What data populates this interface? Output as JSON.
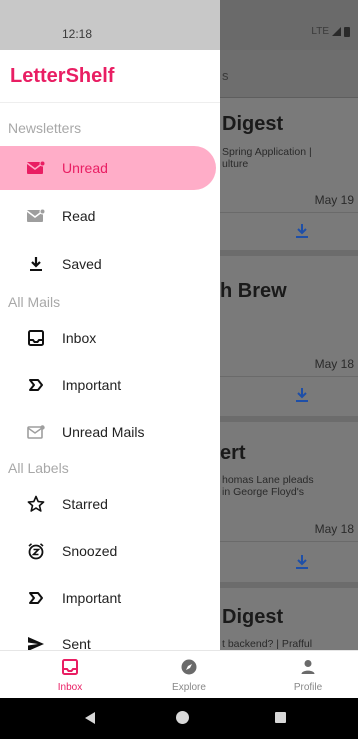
{
  "status_bar": {
    "time": "12:18",
    "network": "LTE"
  },
  "drawer": {
    "title": "LetterShelf",
    "sections": [
      {
        "header": "Newsletters",
        "items": [
          {
            "label": "Unread",
            "icon": "mail-unread-icon",
            "active": true
          },
          {
            "label": "Read",
            "icon": "mail-read-icon"
          },
          {
            "label": "Saved",
            "icon": "download-icon"
          }
        ]
      },
      {
        "header": "All Mails",
        "items": [
          {
            "label": "Inbox",
            "icon": "inbox-icon"
          },
          {
            "label": "Important",
            "icon": "important-icon"
          },
          {
            "label": "Unread Mails",
            "icon": "unread-mail-icon"
          }
        ]
      },
      {
        "header": "All Labels",
        "items": [
          {
            "label": "Starred",
            "icon": "star-icon"
          },
          {
            "label": "Snoozed",
            "icon": "snooze-icon"
          },
          {
            "label": "Important",
            "icon": "important-icon"
          },
          {
            "label": "Sent",
            "icon": "send-icon"
          }
        ]
      }
    ]
  },
  "background": {
    "topbar_partial": "s",
    "cards": [
      {
        "title": "Digest",
        "subtitle_lines": [
          "Spring Application |",
          "ulture"
        ],
        "date": "May 19"
      },
      {
        "title": "h Brew",
        "subtitle_lines": [],
        "date": "May 18"
      },
      {
        "title": "ert",
        "subtitle_lines": [
          "homas Lane pleads",
          "in George Floyd's"
        ],
        "date": "May 18"
      },
      {
        "title": "Digest",
        "subtitle_lines": [
          "t backend? | Prafful"
        ],
        "date": ""
      }
    ]
  },
  "bottom_nav": {
    "items": [
      {
        "label": "Inbox",
        "icon": "inbox-icon",
        "active": true
      },
      {
        "label": "Explore",
        "icon": "compass-icon"
      },
      {
        "label": "Profile",
        "icon": "person-icon"
      }
    ]
  },
  "colors": {
    "accent": "#e91e63",
    "active_bg": "#ffadc8"
  }
}
